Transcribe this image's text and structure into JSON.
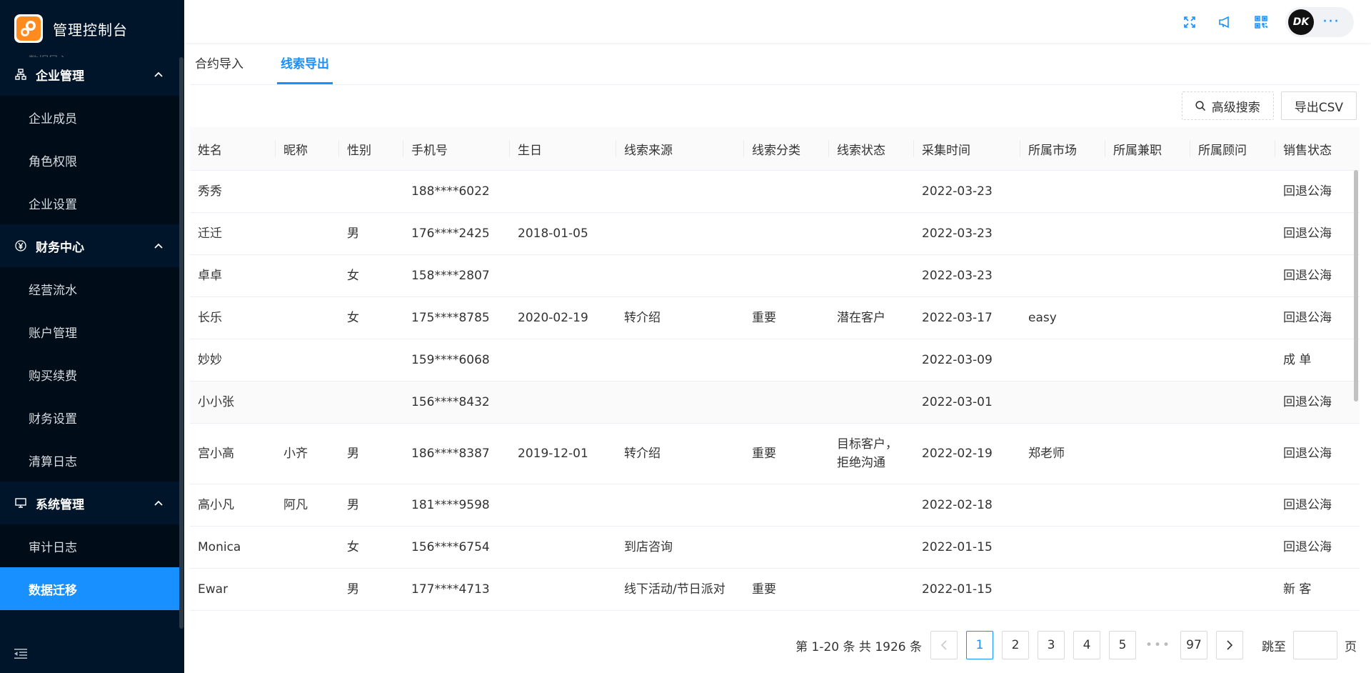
{
  "app": {
    "title": "管理控制台"
  },
  "sidebar": {
    "clipped_item": "数据导入",
    "groups": [
      {
        "label": "企业管理",
        "icon": "org-icon",
        "items": [
          "企业成员",
          "角色权限",
          "企业设置"
        ]
      },
      {
        "label": "财务中心",
        "icon": "yen-icon",
        "items": [
          "经营流水",
          "账户管理",
          "购买续费",
          "财务设置",
          "清算日志"
        ]
      },
      {
        "label": "系统管理",
        "icon": "monitor-icon",
        "items": [
          "审计日志",
          "数据迁移"
        ]
      }
    ],
    "active_item": "数据迁移"
  },
  "header": {
    "avatar_text": "DK",
    "more": "···"
  },
  "tabs": [
    {
      "label": "合约导入",
      "active": false
    },
    {
      "label": "线索导出",
      "active": true
    }
  ],
  "toolbar": {
    "search_label": "高级搜索",
    "export_label": "导出CSV"
  },
  "table": {
    "columns": [
      "姓名",
      "昵称",
      "性别",
      "手机号",
      "生日",
      "线索来源",
      "线索分类",
      "线索状态",
      "采集时间",
      "所属市场",
      "所属兼职",
      "所属顾问",
      "销售状态"
    ],
    "rows": [
      [
        "秀秀",
        "",
        "",
        "188****6022",
        "",
        "",
        "",
        "",
        "2022-03-23",
        "",
        "",
        "",
        "回退公海"
      ],
      [
        "迁迁",
        "",
        "男",
        "176****2425",
        "2018-01-05",
        "",
        "",
        "",
        "2022-03-23",
        "",
        "",
        "",
        "回退公海"
      ],
      [
        "卓卓",
        "",
        "女",
        "158****2807",
        "",
        "",
        "",
        "",
        "2022-03-23",
        "",
        "",
        "",
        "回退公海"
      ],
      [
        "长乐",
        "",
        "女",
        "175****8785",
        "2020-02-19",
        "转介绍",
        "重要",
        "潜在客户",
        "2022-03-17",
        "easy",
        "",
        "",
        "回退公海"
      ],
      [
        "妙妙",
        "",
        "",
        "159****6068",
        "",
        "",
        "",
        "",
        "2022-03-09",
        "",
        "",
        "",
        "成 单"
      ],
      [
        "小小张",
        "",
        "",
        "156****8432",
        "",
        "",
        "",
        "",
        "2022-03-01",
        "",
        "",
        "",
        "回退公海"
      ],
      [
        "宫小高",
        "小齐",
        "男",
        "186****8387",
        "2019-12-01",
        "转介绍",
        "重要",
        "目标客户，拒绝沟通",
        "2022-02-19",
        "郑老师",
        "",
        "",
        "回退公海"
      ],
      [
        "高小凡",
        "阿凡",
        "男",
        "181****9598",
        "",
        "",
        "",
        "",
        "2022-02-18",
        "",
        "",
        "",
        "回退公海"
      ],
      [
        "Monica",
        "",
        "女",
        "156****6754",
        "",
        "到店咨询",
        "",
        "",
        "2022-01-15",
        "",
        "",
        "",
        "回退公海"
      ],
      [
        "Ewar",
        "",
        "男",
        "177****4713",
        "",
        "线下活动/节日派对",
        "重要",
        "",
        "2022-01-15",
        "",
        "",
        "",
        "新 客"
      ]
    ]
  },
  "pagination": {
    "summary": "第 1-20 条 共 1926 条",
    "pages": [
      "1",
      "2",
      "3",
      "4",
      "5"
    ],
    "ellipsis": "•••",
    "last_page": "97",
    "current": "1",
    "jump_label": "跳至",
    "page_suffix": "页"
  },
  "colors": {
    "sidebar_bg": "#001529",
    "accent": "#1890ff"
  }
}
